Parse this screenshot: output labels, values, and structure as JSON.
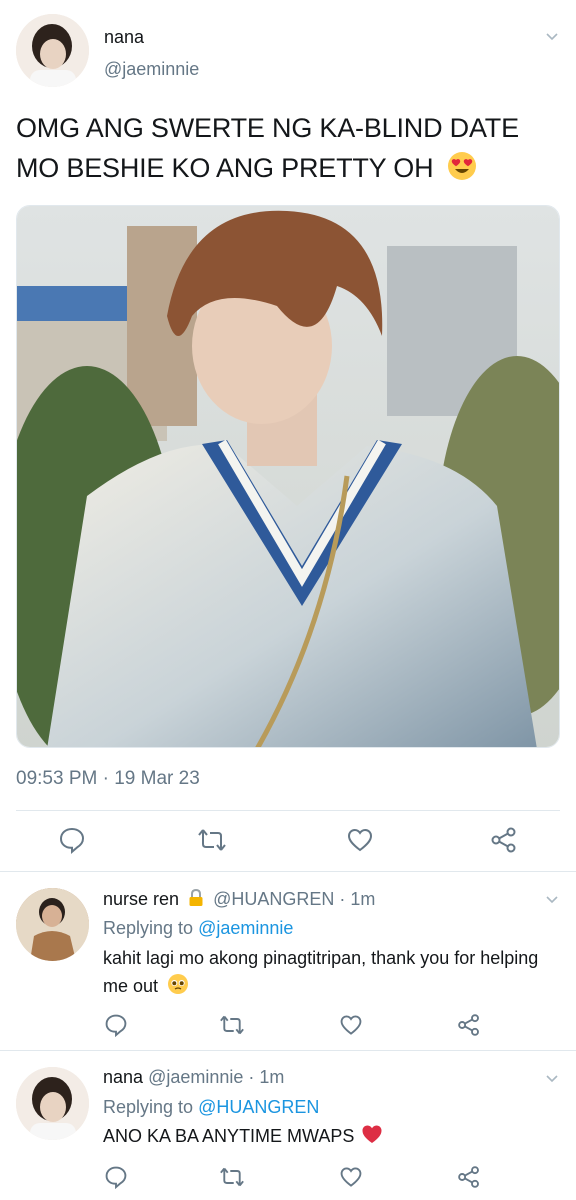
{
  "main_tweet": {
    "author_name": "nana",
    "author_handle": "@jaeminnie",
    "text_line1": "OMG ANG SWERTE NG KA-BLIND DATE",
    "text_line2": "MO BESHIE KO ANG PRETTY OH",
    "timestamp": "09:53 PM · 19 Mar 23",
    "emoji": "heart-eyes-emoji"
  },
  "reply1": {
    "author_name": "nurse ren",
    "lock": "lock-icon",
    "author_handle": "@HUANGREN",
    "time": "· 1m",
    "replying_prefix": "Replying to",
    "replying_to": "@jaeminnie",
    "text_line1": "kahit lagi mo akong pinagtitripan, thank you for helping",
    "text_line2": "me out",
    "emoji": "pleading-face-emoji"
  },
  "reply2": {
    "author_name": "nana",
    "author_handle": "@jaeminnie",
    "time": "· 1m",
    "replying_prefix": "Replying to",
    "replying_to": "@HUANGREN",
    "text": "ANO KA BA ANYTIME MWAPS",
    "emoji": "red-heart-emoji"
  },
  "colors": {
    "text": "#14171a",
    "muted": "#657786",
    "link": "#1b95e0",
    "divider": "#e1e8ed"
  }
}
